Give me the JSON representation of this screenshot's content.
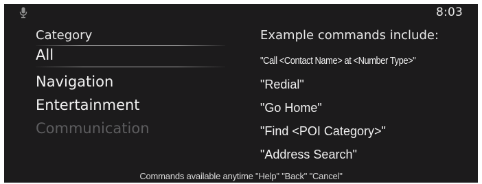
{
  "status": {
    "time": "8:03",
    "mic_icon": "microphone-icon"
  },
  "category_panel": {
    "heading": "Category",
    "items": [
      {
        "label": "All",
        "state": "selected"
      },
      {
        "label": "Navigation",
        "state": "enabled"
      },
      {
        "label": "Entertainment",
        "state": "enabled"
      },
      {
        "label": "Communication",
        "state": "disabled"
      }
    ]
  },
  "examples_panel": {
    "heading": "Example commands include:",
    "commands": [
      "\"Call <Contact Name> at <Number Type>\"",
      "\"Redial\"",
      "\"Go Home\"",
      "\"Find <POI Category>\"",
      "\"Address Search\""
    ]
  },
  "footer": {
    "text": "Commands available anytime \"Help\" \"Back\" \"Cancel\""
  },
  "colors": {
    "background": "#1c1b1c",
    "text": "#f2f2f2",
    "disabled_text": "#5d5d5f"
  }
}
